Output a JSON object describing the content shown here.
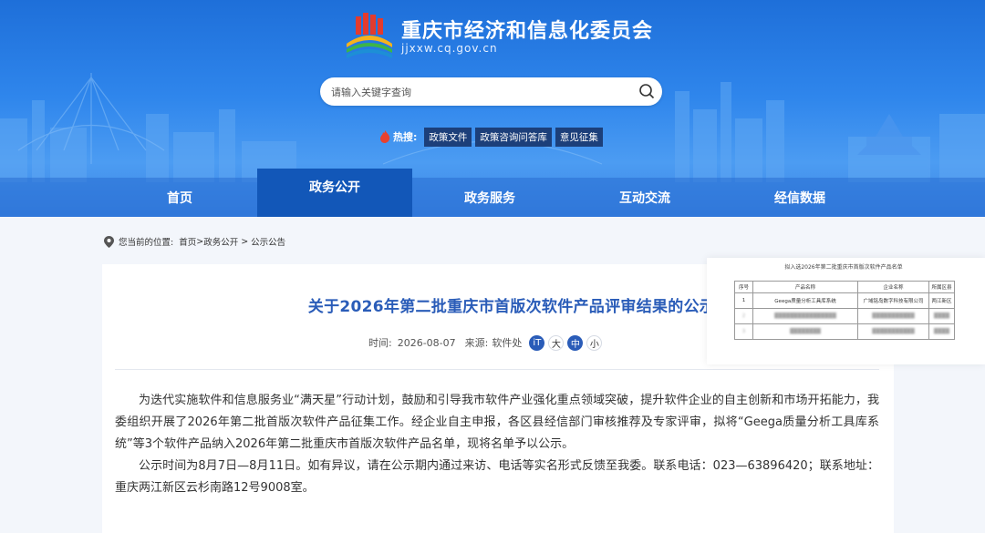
{
  "site": {
    "title": "重庆市经济和信息化委员会",
    "url": "jjxxw.cq.gov.cn"
  },
  "search": {
    "placeholder": "请输入关键字查询"
  },
  "hot": {
    "label": "热搜:",
    "tags": [
      "政策文件",
      "政策咨询问答库",
      "意见征集"
    ]
  },
  "nav": {
    "items": [
      "首页",
      "政务公开",
      "政务服务",
      "互动交流",
      "经信数据"
    ],
    "active_index": 1
  },
  "breadcrumb": {
    "prefix": "您当前的位置:",
    "home": "首页",
    "sep1": ">",
    "section": "政务公开",
    "sep2": ">",
    "current": "公示公告"
  },
  "article": {
    "title": "关于2026年第二批重庆市首版次软件产品评审结果的公示",
    "time_label": "时间:",
    "time_value": "2026-08-07",
    "source_label": "来源:",
    "source_value": "软件处",
    "font_buttons": [
      "iT",
      "大",
      "中",
      "小"
    ],
    "paragraphs": [
      "为迭代实施软件和信息服务业“满天星”行动计划，鼓励和引导我市软件产业强化重点领域突破，提升软件企业的自主创新和市场开拓能力，我委组织开展了2026年第二批首版次软件产品征集工作。经企业自主申报，各区县经信部门审核推荐及专家评审，拟将“Geega质量分析工具库系统”等3个软件产品纳入2026年第二批重庆市首版次软件产品名单，现将名单予以公示。",
      "公示时间为8月7日—8月11日。如有异议，请在公示期内通过来访、电话等实名形式反馈至我委。联系电话：023—63896420；联系地址：重庆两江新区云杉南路12号9008室。"
    ]
  },
  "preview": {
    "title": "拟入选2026年第二批重庆市首版次软件产品名单",
    "headers": [
      "序号",
      "产品名称",
      "企业名称",
      "所属区县"
    ],
    "rows": [
      [
        "1",
        "Geega质量分析工具库系统",
        "广域铭岛数字科技有限公司",
        "两江新区"
      ]
    ]
  }
}
